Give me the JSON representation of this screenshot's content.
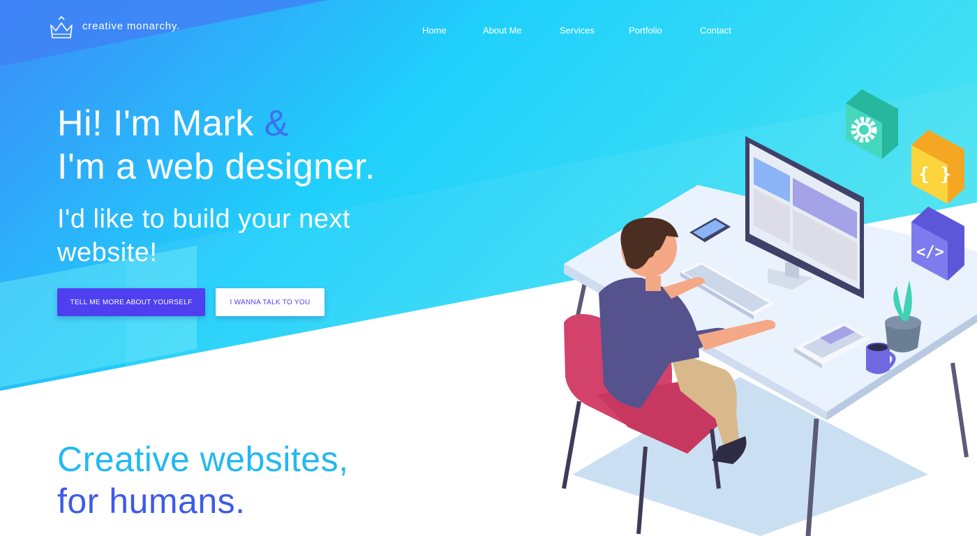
{
  "brand": {
    "name": "creative monarchy."
  },
  "nav": {
    "home": "Home",
    "about": "About Me",
    "services": "Services",
    "portfolio": "Portfolio",
    "contact": "Contact"
  },
  "hero": {
    "line1_prefix": "Hi! I'm Mark ",
    "line1_amp": "&",
    "line2": "I'm a web designer.",
    "subtitle_line1": "I'd like to build your next",
    "subtitle_line2": "website!"
  },
  "buttons": {
    "primary": "TELL ME MORE ABOUT YOURSELF",
    "secondary": "I WANNA TALK TO YOU"
  },
  "tagline": {
    "line1": "Creative websites,",
    "line2": "for humans."
  },
  "illustration": {
    "icons": [
      "gear-icon",
      "braces-icon",
      "code-icon"
    ],
    "braces_glyph": "{ }",
    "code_glyph": "</>"
  },
  "colors": {
    "accent": "#4e3ff1",
    "hero_blue": "#2ab8f5",
    "amp": "#3d6ff2",
    "tagline_cyan": "#22b8f4",
    "tagline_blue": "#3d5be8"
  }
}
